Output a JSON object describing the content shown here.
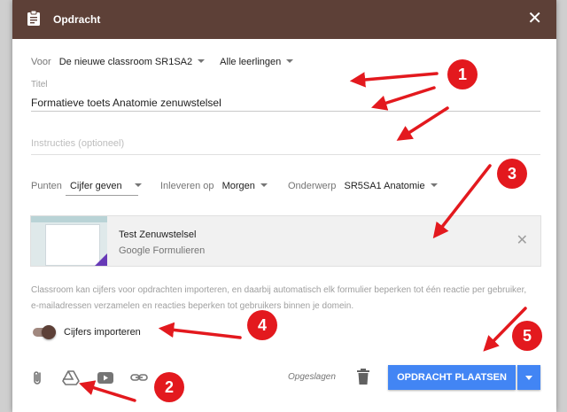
{
  "header": {
    "title": "Opdracht",
    "close_label": "✕"
  },
  "voor": {
    "label": "Voor",
    "class_value": "De nieuwe classroom SR1SA2",
    "students_value": "Alle leerlingen"
  },
  "titel": {
    "label": "Titel",
    "value": "Formatieve toets Anatomie zenuwstelsel"
  },
  "instructions": {
    "placeholder": "Instructies (optioneel)"
  },
  "meta": {
    "points_label": "Punten",
    "points_value": "Cijfer geven",
    "due_label": "Inleveren op",
    "due_value": "Morgen",
    "topic_label": "Onderwerp",
    "topic_value": "SR5SA1 Anatomie"
  },
  "attachment": {
    "title": "Test Zenuwstelsel",
    "subtitle": "Google Formulieren",
    "remove_label": "✕"
  },
  "info_text": "Classroom kan cijfers voor opdrachten importeren, en daarbij automatisch elk formulier beperken tot één reactie per gebruiker, e-mailadressen verzamelen en reacties beperken tot gebruikers binnen je domein.",
  "import_toggle": {
    "label": "Cijfers importeren",
    "on": true
  },
  "footer": {
    "saved_text": "Opgeslagen",
    "post_button": "OPDRACHT PLAATSEN"
  },
  "annotations": [
    "1",
    "2",
    "3",
    "4",
    "5"
  ],
  "colors": {
    "header": "#5d4037",
    "primary_button": "#4285f4",
    "annotation": "#e3191e",
    "toggle_knob": "#5d4037"
  },
  "icons": [
    "assignment-icon",
    "close-icon",
    "paperclip-icon",
    "google-drive-icon",
    "youtube-icon",
    "link-icon",
    "trash-icon",
    "chevron-down-icon"
  ]
}
